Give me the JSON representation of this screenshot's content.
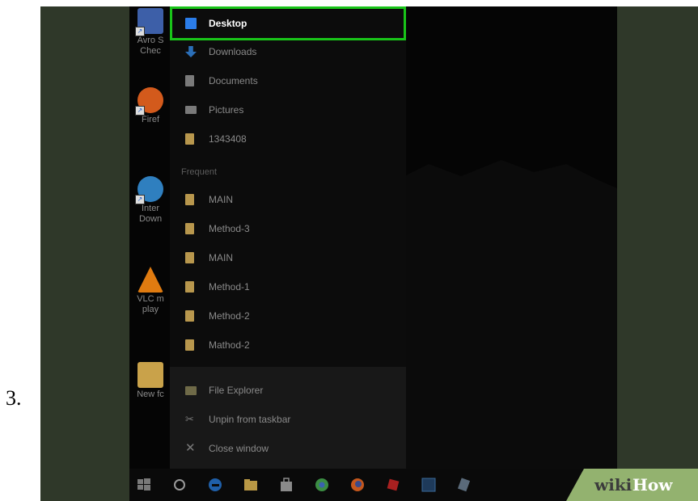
{
  "step_number": "3.",
  "desktop_icons": [
    {
      "label_line1": "Avro S",
      "label_line2": "Chec",
      "icon": "avro-keyboard-icon",
      "color": "#3d5fa8"
    },
    {
      "label_line1": "Firef",
      "label_line2": "",
      "icon": "firefox-icon",
      "color": "#d35a1c"
    },
    {
      "label_line1": "Inter",
      "label_line2": "Down",
      "icon": "internet-download-manager-icon",
      "color": "#2f7fbf"
    },
    {
      "label_line1": "VLC m",
      "label_line2": "play",
      "icon": "vlc-icon",
      "color": "#e07b10"
    },
    {
      "label_line1": "New fc",
      "label_line2": "",
      "icon": "folder-icon",
      "color": "#c9a24a"
    }
  ],
  "jump_list": {
    "pinned": [
      {
        "label": "Desktop",
        "icon": "desktop-icon",
        "color": "#2b7de9"
      },
      {
        "label": "Downloads",
        "icon": "downloads-icon",
        "color": "#2b6fb8"
      },
      {
        "label": "Documents",
        "icon": "documents-icon",
        "color": "#7a7a7a"
      },
      {
        "label": "Pictures",
        "icon": "pictures-icon",
        "color": "#7a7a7a"
      },
      {
        "label": "1343408",
        "icon": "folder-icon",
        "color": "#b8974d"
      }
    ],
    "frequent_title": "Frequent",
    "frequent": [
      {
        "label": "MAIN",
        "icon": "folder-icon",
        "color": "#b8974d"
      },
      {
        "label": "Method-3",
        "icon": "folder-icon",
        "color": "#b8974d"
      },
      {
        "label": "MAIN",
        "icon": "folder-icon",
        "color": "#b8974d"
      },
      {
        "label": "Method-1",
        "icon": "folder-icon",
        "color": "#b8974d"
      },
      {
        "label": "Method-2",
        "icon": "folder-icon",
        "color": "#b8974d"
      },
      {
        "label": "Mathod-2",
        "icon": "folder-icon",
        "color": "#b8974d"
      }
    ],
    "actions": [
      {
        "label": "File Explorer",
        "icon": "file-explorer-icon"
      },
      {
        "label": "Unpin from taskbar",
        "icon": "unpin-icon"
      },
      {
        "label": "Close window",
        "icon": "close-icon"
      }
    ],
    "highlight_color": "#19c419"
  },
  "taskbar": [
    {
      "icon": "windows-start-icon",
      "color": "#7a7a7a"
    },
    {
      "icon": "cortana-search-icon",
      "color": "#9a9a9a"
    },
    {
      "icon": "edge-icon",
      "color": "#1f5fa8"
    },
    {
      "icon": "file-explorer-icon",
      "color": "#b99845"
    },
    {
      "icon": "store-icon",
      "color": "#8a8a8a"
    },
    {
      "icon": "chrome-icon",
      "color": "#3b8d43"
    },
    {
      "icon": "firefox-icon",
      "color": "#c4571d"
    },
    {
      "icon": "roblox-icon",
      "color": "#a82020"
    },
    {
      "icon": "photoshop-icon",
      "color": "#1e3a5a"
    },
    {
      "icon": "app-icon",
      "color": "#5a6a7a"
    }
  ],
  "watermark": {
    "wiki": "wiki",
    "how": "How"
  }
}
